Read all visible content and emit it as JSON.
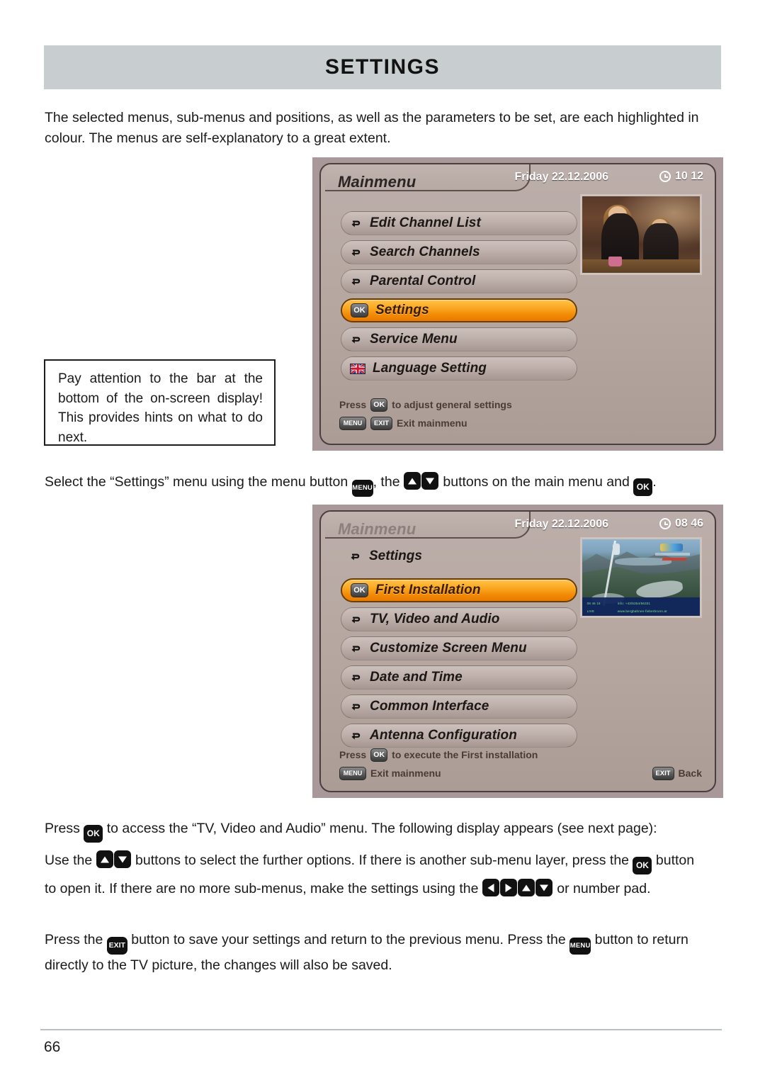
{
  "document": {
    "title": "SETTINGS",
    "page_number": "66"
  },
  "intro_paragraph": "The selected menus, sub-menus and positions, as well as the parameters to be set, are each highlighted in colour. The menus are self-explanatory to a great extent.",
  "note_box": {
    "text": "Pay attention to the bar at the bottom of the on-screen display! This provides hints on what to do next."
  },
  "paragraphs": {
    "select_1": "Select the “Settings” menu using the menu button",
    "select_2": ", the",
    "select_3": "buttons on the main menu and",
    "select_4": ".",
    "press_ok_1": "Press",
    "press_ok_2": "to access the “TV, Video and Audio” menu. The following display appears (see next page):",
    "use_1": "Use the",
    "use_2": "buttons to select the further options. If there is another sub-menu layer, press the",
    "use_3": "button",
    "open_1": "to open it. If there are no more sub-menus, make the settings using the",
    "open_2": "or number pad.",
    "exit_1": "Press the",
    "exit_2": "button to save your settings and return to the previous menu. Press the",
    "exit_3": "button to return directly to the TV picture, the changes will also be saved."
  },
  "keys": {
    "menu": "MENU",
    "exit": "EXIT",
    "ok": "OK"
  },
  "osd_mainmenu": {
    "title": "Mainmenu",
    "date": "Friday 22.12.2006",
    "time": "10 12",
    "items": [
      {
        "label": "Edit Channel List",
        "icon": "return-arrow-icon",
        "selected": false
      },
      {
        "label": "Search Channels",
        "icon": "return-arrow-icon",
        "selected": false
      },
      {
        "label": "Parental Control",
        "icon": "return-arrow-icon",
        "selected": false
      },
      {
        "label": "Settings",
        "icon": "ok-chip-icon",
        "selected": true
      },
      {
        "label": "Service Menu",
        "icon": "return-arrow-icon",
        "selected": false
      },
      {
        "label": "Language Setting",
        "icon": "union-jack-flag-icon",
        "selected": false
      }
    ],
    "hint_press_prefix": "Press",
    "hint_press_key": "OK",
    "hint_press_suffix": "to adjust general settings",
    "hint_exit_key_1": "MENU",
    "hint_exit_key_2": "EXIT",
    "hint_exit_label": "Exit mainmenu"
  },
  "osd_settings": {
    "title": "Mainmenu",
    "breadcrumb": "Settings",
    "date": "Friday 22.12.2006",
    "time": "08 46",
    "items": [
      {
        "label": "First Installation",
        "icon": "ok-chip-icon",
        "selected": true
      },
      {
        "label": "TV, Video and Audio",
        "icon": "return-arrow-icon",
        "selected": false
      },
      {
        "label": "Customize Screen Menu",
        "icon": "return-arrow-icon",
        "selected": false
      },
      {
        "label": "Date and Time",
        "icon": "return-arrow-icon",
        "selected": false
      },
      {
        "label": "Common Interface",
        "icon": "return-arrow-icon",
        "selected": false
      },
      {
        "label": "Antenna Configuration",
        "icon": "return-arrow-icon",
        "selected": false
      }
    ],
    "hint_press_prefix": "Press",
    "hint_press_key": "OK",
    "hint_press_suffix": "to execute the First installation",
    "hint_exit_key_1": "MENU",
    "hint_exit_label": "Exit mainmenu",
    "hint_back_key": "EXIT",
    "hint_back_label": "Back",
    "preview_overlay": {
      "line1_left": "08 46 16",
      "line2_left": "LIVE",
      "line1_right": "info: +43/5354/56331",
      "line2_right": "www.bergbahnen-fieberbrunn.at"
    }
  },
  "colors": {
    "banner": "#C8CDD0",
    "highlight_orange": "#FBA822",
    "osd_panel": "#B7A9A3",
    "footer_rule": "#B9C0C4"
  }
}
